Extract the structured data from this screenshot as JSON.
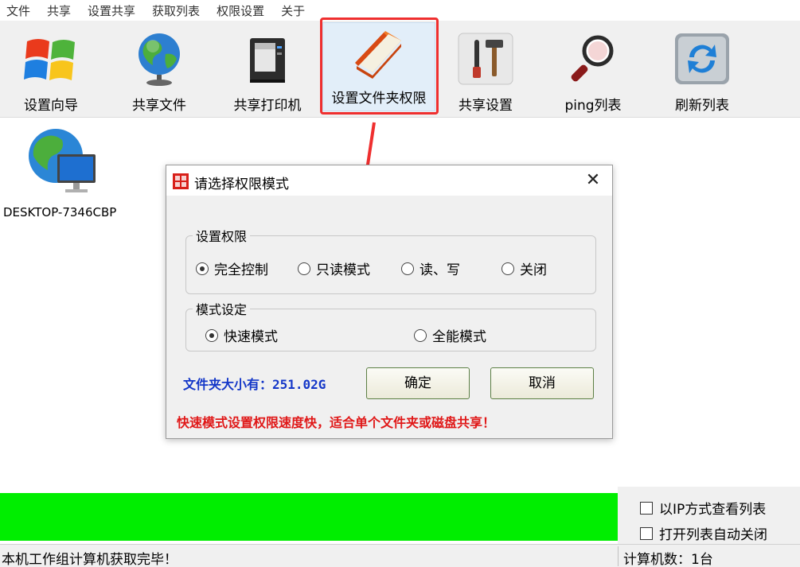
{
  "menu": [
    "文件",
    "共享",
    "设置共享",
    "获取列表",
    "权限设置",
    "关于"
  ],
  "toolbar": [
    {
      "label": "设置向导",
      "icon": "windows-logo-icon"
    },
    {
      "label": "共享文件",
      "icon": "globe-icon"
    },
    {
      "label": "共享打印机",
      "icon": "printer-icon"
    },
    {
      "label": "设置文件夹权限",
      "icon": "folder-book-icon",
      "highlighted": true
    },
    {
      "label": "共享设置",
      "icon": "tools-icon"
    },
    {
      "label": "ping列表",
      "icon": "magnifier-icon"
    },
    {
      "label": "刷新列表",
      "icon": "refresh-icon"
    }
  ],
  "computers": [
    {
      "name": "DESKTOP-7346CBP",
      "icon": "network-computer-icon"
    }
  ],
  "dialog": {
    "title": "请选择权限模式",
    "close": "✕",
    "permission_group": {
      "legend": "设置权限",
      "options": [
        "完全控制",
        "只读模式",
        "读、写",
        "关闭"
      ],
      "selected": "完全控制"
    },
    "mode_group": {
      "legend": "模式设定",
      "options": [
        "快速模式",
        "全能模式"
      ],
      "selected": "快速模式"
    },
    "folder_size": "文件夹大小有：251.02G",
    "ok": "确定",
    "cancel": "取消",
    "hint": "快速模式设置权限速度快，适合单个文件夹或磁盘共享！"
  },
  "progress": {
    "value": 1.0,
    "color": "#00ee00"
  },
  "options": {
    "view_by_ip": {
      "label": "以IP方式查看列表",
      "checked": false
    },
    "auto_close": {
      "label": "打开列表自动关闭",
      "checked": false
    }
  },
  "status": {
    "message": "本机工作组计算机获取完毕！",
    "count": "计算机数：1台"
  },
  "colors": {
    "highlight_frame": "#ef2f2f",
    "size_text": "#1437c8",
    "hint_text": "#e01818"
  }
}
